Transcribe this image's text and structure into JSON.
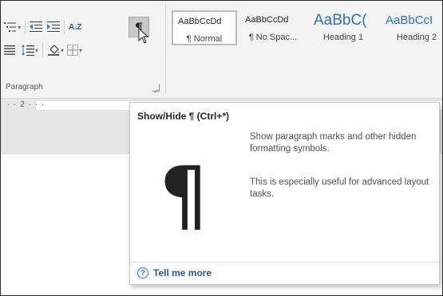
{
  "paragraph_group": {
    "label": "Paragraph",
    "sort_glyph": "A↓Z",
    "show_hide_glyph": "¶"
  },
  "styles": [
    {
      "sample": "AaBbCcDd",
      "name": "¶ Normal"
    },
    {
      "sample": "AaBbCcDd",
      "name": "¶ No Spac..."
    },
    {
      "sample": "AaBbC(",
      "name": "Heading 1"
    },
    {
      "sample": "AaBbCcI",
      "name": "Heading 2"
    }
  ],
  "ruler": {
    "text": "·  ·  2  ·  ·  ·"
  },
  "tooltip": {
    "title": "Show/Hide ¶ (Ctrl+*)",
    "description": "Show paragraph marks and other hidden formatting symbols.",
    "extra": "This is especially useful for advanced layout tasks.",
    "big_glyph": "¶",
    "help_glyph": "?",
    "link_label": "Tell me more"
  },
  "colors": {
    "ribbon_bg": "#f3f3f3",
    "heading_blue": "#2e74b5",
    "link_blue": "#2b5797",
    "selected_button": "#c9c9c9"
  }
}
